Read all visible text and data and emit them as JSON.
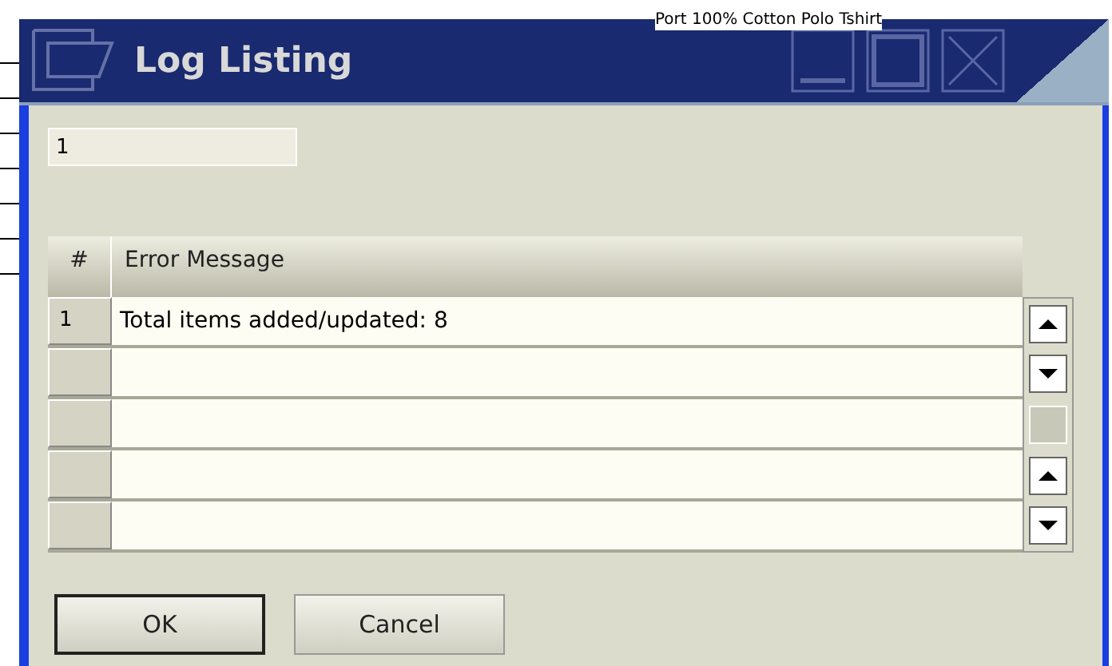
{
  "background": {
    "text": "Port 100% Cotton Polo Tshirt"
  },
  "window": {
    "title": "Log Listing"
  },
  "field": {
    "value": "1"
  },
  "table": {
    "columns": [
      "#",
      "Error Message"
    ],
    "rows": [
      {
        "number": "1",
        "message": "Total items added/updated: 8"
      }
    ]
  },
  "buttons": [
    {
      "label": "OK",
      "default": true
    },
    {
      "label": "Cancel",
      "default": false
    }
  ]
}
